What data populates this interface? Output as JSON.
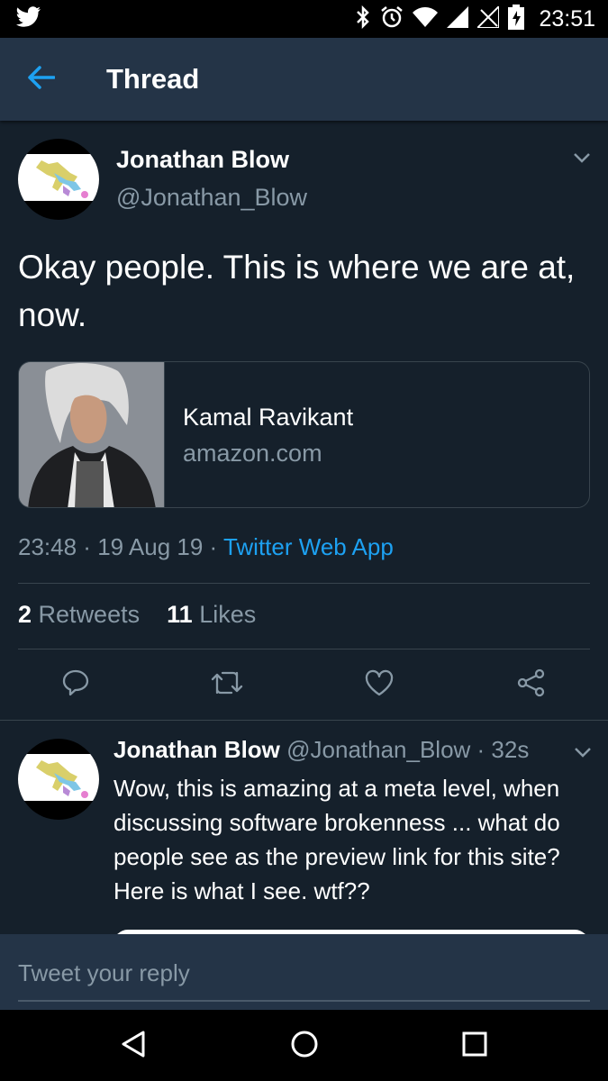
{
  "status_bar": {
    "time": "23:51",
    "icons": [
      "twitter-bird-icon",
      "bluetooth-icon",
      "alarm-icon",
      "wifi-icon",
      "signal-icon",
      "no-signal-icon",
      "battery-charging-icon"
    ]
  },
  "header": {
    "title": "Thread",
    "back_icon": "arrow-left-icon"
  },
  "main_tweet": {
    "author_name": "Jonathan Blow",
    "author_handle": "@Jonathan_Blow",
    "text": "Okay people. This is where we are at, now.",
    "card": {
      "title": "Kamal Ravikant",
      "domain": "amazon.com"
    },
    "time": "23:48",
    "sep1": " · ",
    "date": "19 Aug 19",
    "sep2": " · ",
    "source": "Twitter Web App",
    "retweets_count": "2",
    "retweets_label": "Retweets",
    "likes_count": "11",
    "likes_label": "Likes",
    "actions": [
      "reply-icon",
      "retweet-icon",
      "like-icon",
      "share-icon"
    ]
  },
  "reply_tweet": {
    "author_name": "Jonathan Blow",
    "meta": " @Jonathan_Blow · 32s",
    "text": "Wow, this is amazing at a meta level, when discussing software brokenness ... what do people see as the preview link for this site? Here is what I see. wtf??"
  },
  "composer": {
    "placeholder": "Tweet your reply"
  },
  "nav": [
    "back-triangle-icon",
    "home-circle-icon",
    "recents-square-icon"
  ],
  "colors": {
    "background": "#15202b",
    "header": "#243447",
    "accent": "#1da1f2",
    "secondary_text": "#8899a6",
    "divider": "#38444d"
  }
}
